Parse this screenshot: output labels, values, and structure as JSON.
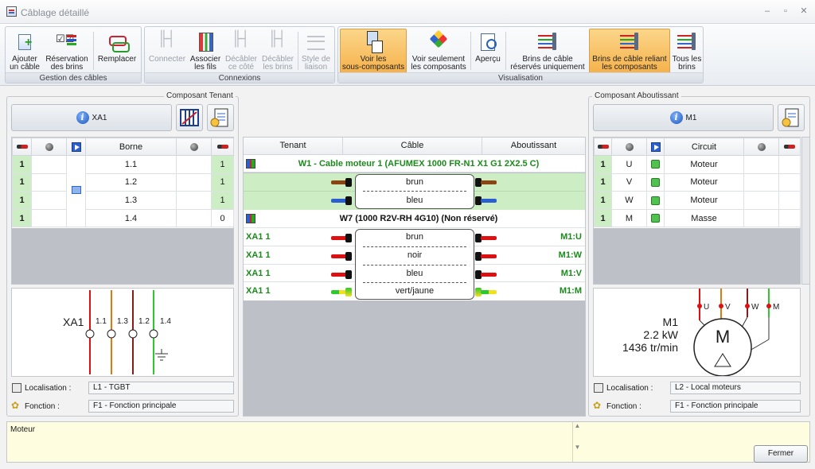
{
  "window": {
    "title": "Câblage détaillé",
    "min": "–",
    "max": "▫",
    "close": "✕"
  },
  "ribbon": {
    "groups": [
      {
        "label": "Gestion des câbles",
        "buttons": [
          {
            "label": "Ajouter\nun câble",
            "icon": "add-cable-icon"
          },
          {
            "label": "Réservation\ndes brins",
            "icon": "reserve-wires-icon"
          },
          {
            "label": "Remplacer",
            "icon": "replace-icon"
          }
        ]
      },
      {
        "label": "Connexions",
        "buttons": [
          {
            "label": "Connecter",
            "icon": "connect-icon"
          },
          {
            "label": "Associer\nles fils",
            "icon": "associate-wires-icon"
          },
          {
            "label": "Décâbler\nce côté",
            "icon": "uncable-side-icon"
          },
          {
            "label": "Décâbler\nles brins",
            "icon": "uncable-wires-icon"
          },
          {
            "label": "Style de\nliaison",
            "icon": "link-style-icon"
          }
        ]
      },
      {
        "label": "Visualisation",
        "buttons": [
          {
            "label": "Voir les\nsous-composants",
            "icon": "subcomponents-icon"
          },
          {
            "label": "Voir seulement\nles composants",
            "icon": "components-icon"
          },
          {
            "label": "Aperçu",
            "icon": "preview-icon"
          },
          {
            "label": "Brins de câble\nréservés uniquement",
            "icon": "reserved-wires-icon"
          },
          {
            "label": "Brins de câble reliant\nles composants",
            "icon": "linking-wires-icon"
          },
          {
            "label": "Tous les\nbrins",
            "icon": "all-wires-icon"
          }
        ]
      }
    ]
  },
  "left": {
    "title": "Composant Tenant",
    "component": "XA1",
    "headers": [
      "Borne"
    ],
    "rows": [
      {
        "n": "1",
        "borne": "1.1",
        "v": "1"
      },
      {
        "n": "1",
        "borne": "1.2",
        "v": "1"
      },
      {
        "n": "1",
        "borne": "1.3",
        "v": "1"
      },
      {
        "n": "1",
        "borne": "1.4",
        "v": "0"
      }
    ],
    "schema": {
      "name": "XA1",
      "terminals": [
        "1.1",
        "1.3",
        "1.2",
        "1.4"
      ]
    },
    "localisation_label": "Localisation :",
    "localisation": "L1 - TGBT",
    "fonction_label": "Fonction :",
    "fonction": "F1 - Fonction principale"
  },
  "center": {
    "headers": [
      "Tenant",
      "Câble",
      "Aboutissant"
    ],
    "cable1": {
      "title": "W1 - Cable moteur 1 (AFUMEX 1000 FR-N1 X1 G1 2X2.5 C)",
      "wires": [
        {
          "color": "brun"
        },
        {
          "color": "bleu"
        }
      ]
    },
    "cable2": {
      "title": "W7 (1000 R2V-RH 4G10) (Non réservé)",
      "wires": [
        {
          "tenant": "XA1 1",
          "color": "brun",
          "abo": "M1:U"
        },
        {
          "tenant": "XA1 1",
          "color": "noir",
          "abo": "M1:W"
        },
        {
          "tenant": "XA1 1",
          "color": "bleu",
          "abo": "M1:V"
        },
        {
          "tenant": "XA1 1",
          "color": "vert/jaune",
          "abo": "M1:M"
        }
      ]
    }
  },
  "right": {
    "title": "Composant Aboutissant",
    "component": "M1",
    "headers": [
      "Circuit"
    ],
    "rows": [
      {
        "n": "1",
        "pin": "U",
        "circuit": "Moteur"
      },
      {
        "n": "1",
        "pin": "V",
        "circuit": "Moteur"
      },
      {
        "n": "1",
        "pin": "W",
        "circuit": "Moteur"
      },
      {
        "n": "1",
        "pin": "M",
        "circuit": "Masse"
      }
    ],
    "schema": {
      "name": "M1",
      "power": "2.2 kW",
      "speed": "1436 tr/min",
      "symbol": "M",
      "pins": [
        "U",
        "V",
        "W",
        "M"
      ]
    },
    "localisation_label": "Localisation :",
    "localisation": "L2 - Local moteurs",
    "fonction_label": "Fonction :",
    "fonction": "F1 - Fonction principale"
  },
  "notes": "Moteur",
  "close_button": "Fermer",
  "colors": {
    "active": "#f6b24c",
    "green_row": "#cdeec4",
    "green_text": "#1a8a1a",
    "notes_bg": "#fefde0"
  }
}
